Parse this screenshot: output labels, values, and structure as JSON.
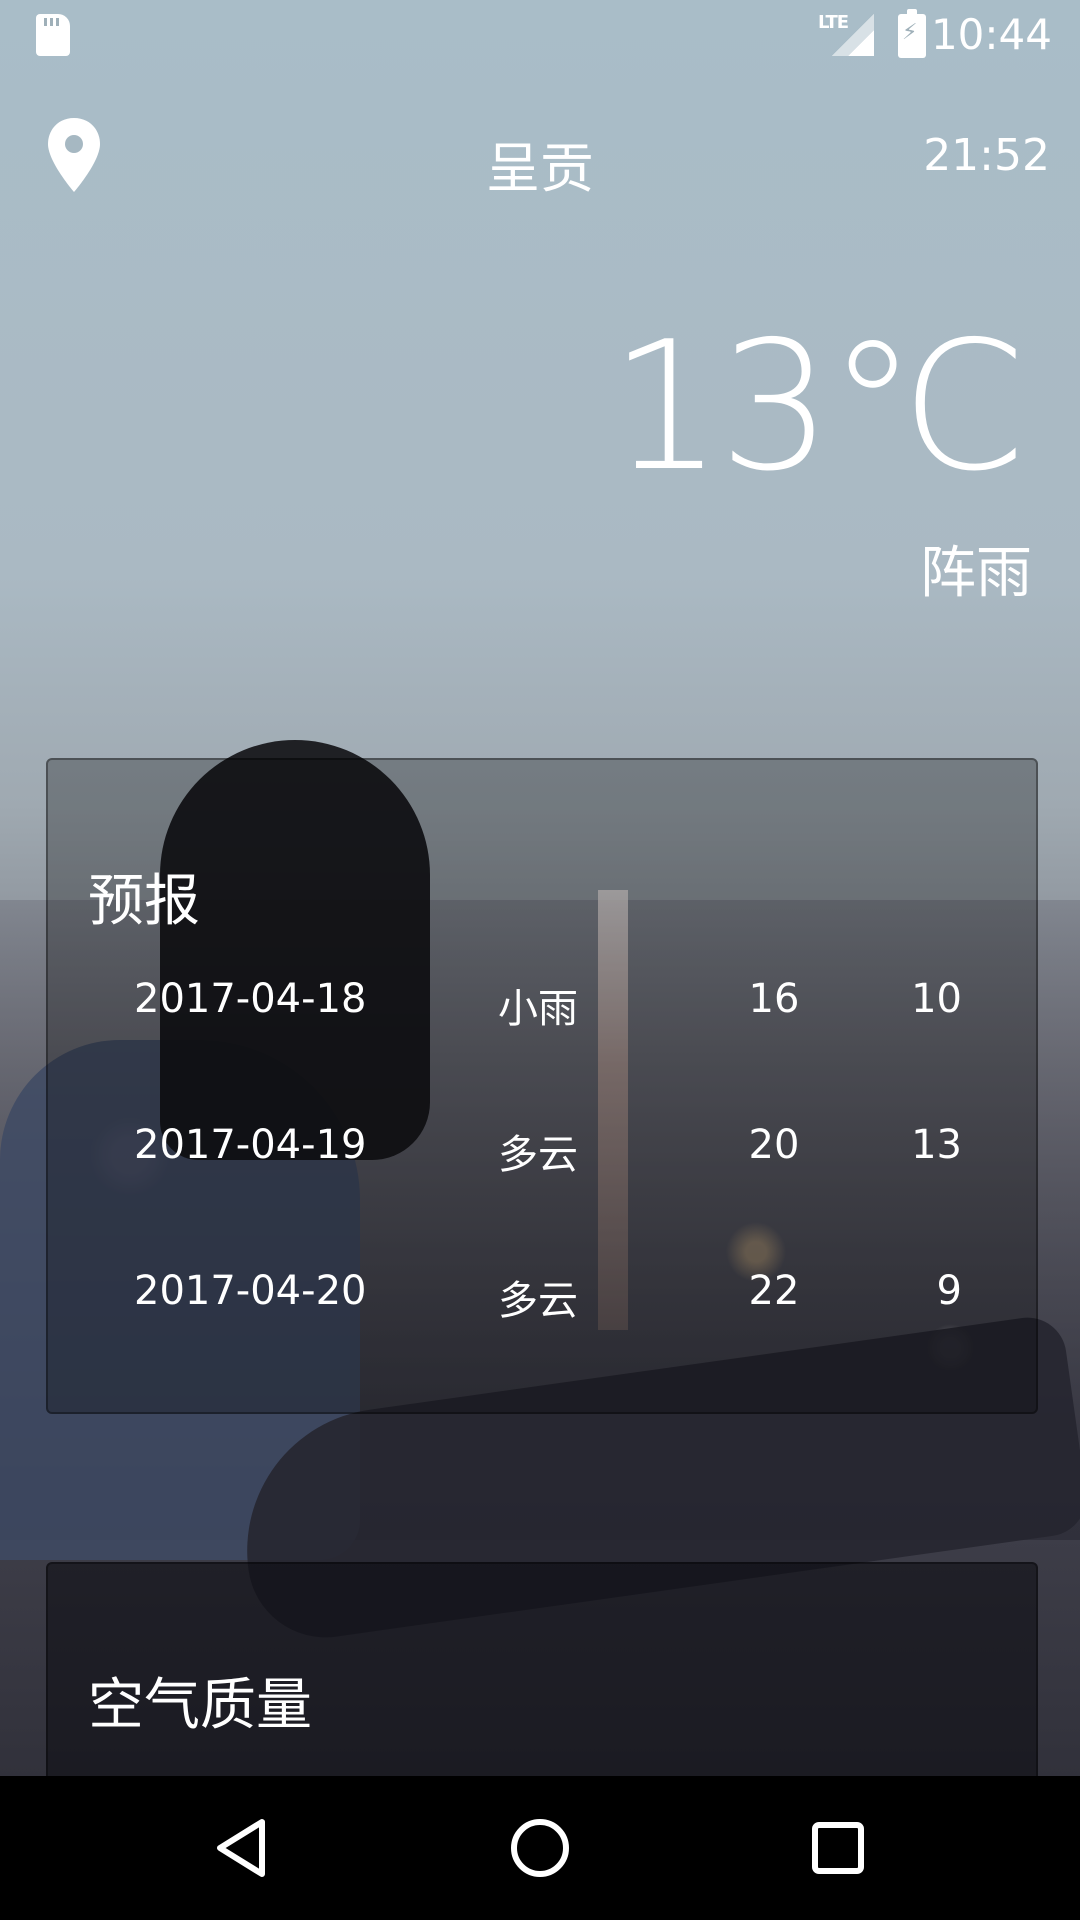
{
  "status_bar": {
    "network": "LTE",
    "time": "10:44"
  },
  "header": {
    "city": "呈贡",
    "update_time": "21:52"
  },
  "now": {
    "temperature": "13℃",
    "condition": "阵雨"
  },
  "forecast": {
    "title": "预报",
    "rows": [
      {
        "date": "2017-04-18",
        "condition": "小雨",
        "max": "16",
        "min": "10"
      },
      {
        "date": "2017-04-19",
        "condition": "多云",
        "max": "20",
        "min": "13"
      },
      {
        "date": "2017-04-20",
        "condition": "多云",
        "max": "22",
        "min": "9"
      }
    ]
  },
  "aqi": {
    "title": "空气质量"
  },
  "icons": {
    "location": "location-pin-icon",
    "sd": "sd-card-icon",
    "signal": "signal-icon",
    "battery": "battery-charging-icon",
    "back": "back-triangle-icon",
    "home": "home-circle-icon",
    "recent": "recent-square-icon"
  }
}
